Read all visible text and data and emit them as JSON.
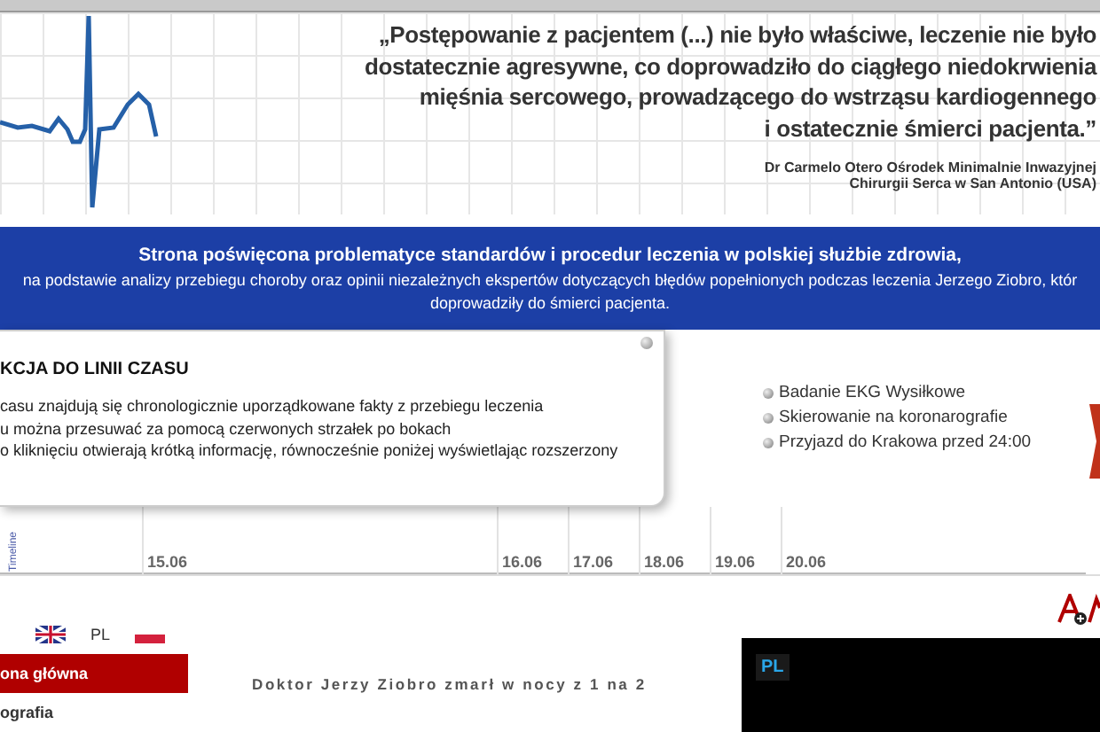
{
  "header": {
    "quote_lines": [
      "„Postępowanie z pacjentem (...) nie było właściwe, leczenie nie było",
      "dostatecznie agresywne, co doprowadziło do ciągłego niedokrwienia",
      "mięśnia sercowego, prowadzącego do wstrząsu kardiogennego",
      "i ostatecznie śmierci pacjenta.”"
    ],
    "author_lines": [
      "Dr Carmelo Otero Ośrodek Minimalnie Inwazyjnej",
      "Chirurgii Serca w San Antonio (USA)"
    ]
  },
  "banner": {
    "title": "Strona poświęcona problematyce standardów i procedur leczenia w polskiej służbie zdrowia,",
    "text": "na podstawie analizy przebiegu choroby oraz opinii niezależnych ekspertów dotyczących błędów popełnionych podczas leczenia Jerzego Ziobro, któr",
    "text_end": "doprowadziły do śmierci pacjenta."
  },
  "timeline": {
    "popup": {
      "title": "KCJA DO LINII CZASU",
      "lines": [
        "casu znajdują się chronologicznie uporządkowane fakty z przebiegu leczenia",
        "u można przesuwać za pomocą czerwonych strzałek po bokach",
        "o kliknięciu otwierają krótką informację, równocześnie poniżej wyświetlając rozszerzony"
      ]
    },
    "label": "Timeline",
    "events": [
      "Badanie EKG Wysiłkowe",
      "Skierowanie na koronarografie",
      "Przyjazd do Krakowa przed 24:00"
    ],
    "ticks": [
      "15.06",
      "16.06",
      "17.06",
      "18.06",
      "19.06",
      "20.06"
    ]
  },
  "languages": [
    {
      "kind": "flag-uk"
    },
    {
      "kind": "text",
      "label": "PL"
    },
    {
      "kind": "flag-pl"
    }
  ],
  "menu": [
    {
      "label": "ona główna",
      "selected": true
    },
    {
      "label": "ografia",
      "selected": false
    }
  ],
  "article": {
    "text": "Doktor Jerzy Ziobro zmarł w nocy z 1 na 2"
  },
  "video": {
    "badge": "PL"
  }
}
